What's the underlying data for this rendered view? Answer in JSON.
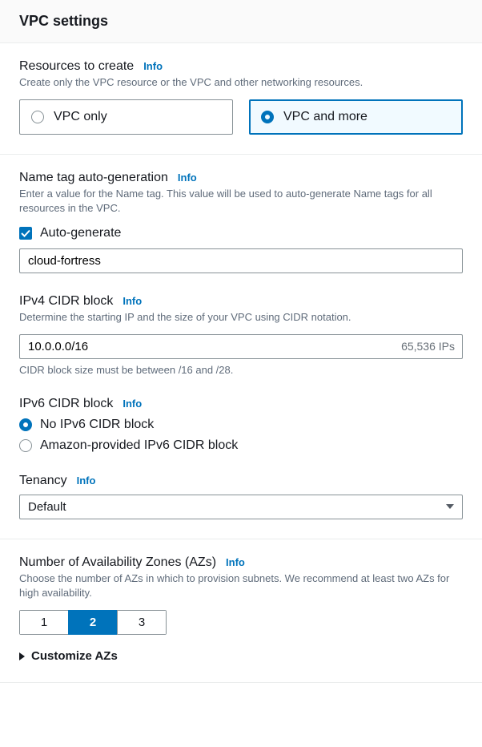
{
  "header": {
    "title": "VPC settings"
  },
  "info_label": "Info",
  "resources": {
    "heading": "Resources to create",
    "description": "Create only the VPC resource or the VPC and other networking resources.",
    "options": [
      {
        "label": "VPC only",
        "selected": false
      },
      {
        "label": "VPC and more",
        "selected": true
      }
    ]
  },
  "nametag": {
    "heading": "Name tag auto-generation",
    "description": "Enter a value for the Name tag. This value will be used to auto-generate Name tags for all resources in the VPC.",
    "checkbox_label": "Auto-generate",
    "checkbox_checked": true,
    "value": "cloud-fortress"
  },
  "ipv4": {
    "heading": "IPv4 CIDR block",
    "description": "Determine the starting IP and the size of your VPC using CIDR notation.",
    "value": "10.0.0.0/16",
    "count": "65,536 IPs",
    "hint": "CIDR block size must be between /16 and /28."
  },
  "ipv6": {
    "heading": "IPv6 CIDR block",
    "options": [
      {
        "label": "No IPv6 CIDR block",
        "selected": true
      },
      {
        "label": "Amazon-provided IPv6 CIDR block",
        "selected": false
      }
    ]
  },
  "tenancy": {
    "heading": "Tenancy",
    "value": "Default"
  },
  "azs": {
    "heading": "Number of Availability Zones (AZs)",
    "description": "Choose the number of AZs in which to provision subnets. We recommend at least two AZs for high availability.",
    "options": [
      "1",
      "2",
      "3"
    ],
    "selected": "2",
    "customize_label": "Customize AZs"
  }
}
